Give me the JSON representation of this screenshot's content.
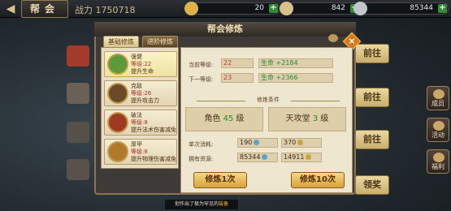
{
  "topbar": {
    "guild_title": "帮会",
    "power_label": "战力 1750718",
    "resources": [
      {
        "name": "gold",
        "value": "20",
        "color": "#e0b14a"
      },
      {
        "name": "ingot",
        "value": "842",
        "color": "#d7c08a"
      },
      {
        "name": "silver",
        "value": "85344",
        "color": "#c0c6cc"
      }
    ],
    "plus_label": "+"
  },
  "side_buttons": [
    "成员",
    "活动",
    "福利"
  ],
  "goto_buttons": [
    "前往",
    "前往",
    "前往",
    "领奖"
  ],
  "panel": {
    "title": "帮会修炼",
    "close_label": "×",
    "help_label": "属性预览",
    "tabs": {
      "basic": "基础修炼",
      "advanced": "进阶修炼"
    },
    "skills": [
      {
        "name": "强健",
        "level": "等级:22",
        "desc": "提升生命",
        "color": "#5a9a3a"
      },
      {
        "name": "克敌",
        "level": "等级:26",
        "desc": "提升攻击力",
        "color": "#6b4a2a"
      },
      {
        "name": "破法",
        "level": "等级:8",
        "desc": "提升法术伤害减免",
        "color": "#a03a22"
      },
      {
        "name": "厚甲",
        "level": "等级:8",
        "desc": "提升物理伤害减免",
        "color": "#b07a2a"
      }
    ],
    "detail": {
      "skill_title": "强健",
      "current_level_label": "当前等级:",
      "current_level": "22",
      "current_effect": "生命 +2184",
      "next_level_label": "下一等级:",
      "next_level": "23",
      "next_effect": "生命 +2366",
      "condition_title": "修炼条件",
      "role_req_label": "角色",
      "role_req_value": "45",
      "role_req_unit": "级",
      "hall_req_label": "天攻堂",
      "hall_req_value": "3",
      "hall_req_unit": "级",
      "cost_label": "单次消耗:",
      "cost_a": "190",
      "cost_b": "370",
      "owned_label": "拥有资源:",
      "owned_a": "85344",
      "owned_b": "14911",
      "train_once": "修炼1次",
      "train_ten": "修炼10次"
    }
  },
  "toast": {
    "prefix": "划作出了极为罕见的",
    "highlight": "装备"
  }
}
